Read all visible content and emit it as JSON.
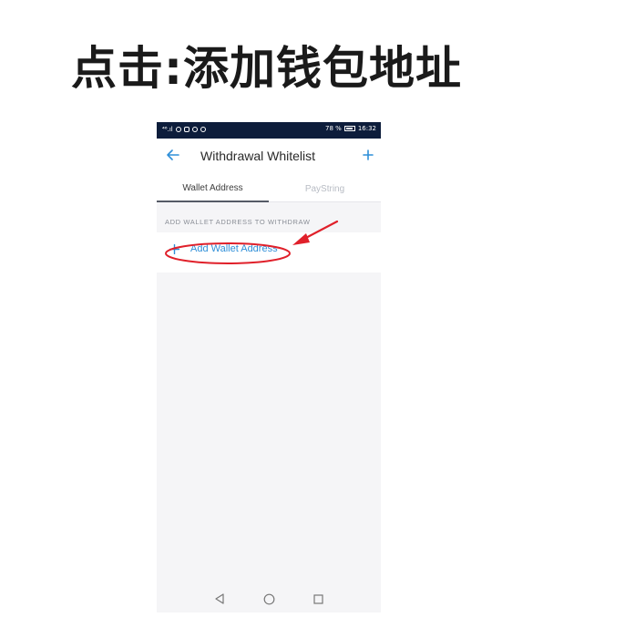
{
  "headline": "点击:添加钱包地址",
  "status_bar": {
    "left_text": "⁴⁶.ıl",
    "battery": "78 %",
    "time": "16:32"
  },
  "app_bar": {
    "title": "Withdrawal Whitelist",
    "back_icon": "arrow-left-icon",
    "add_icon": "plus-icon"
  },
  "tabs": [
    {
      "label": "Wallet Address",
      "active": true
    },
    {
      "label": "PayString",
      "active": false
    }
  ],
  "section": {
    "header": "ADD WALLET ADDRESS TO WITHDRAW",
    "add_button_label": "Add Wallet Address"
  },
  "colors": {
    "accent": "#2f8fd8",
    "status_bar": "#0d1d3b",
    "annotation_red": "#e0202a"
  },
  "nav_bar": {
    "back_icon": "triangle-back-icon",
    "home_icon": "circle-home-icon",
    "recents_icon": "square-recents-icon"
  }
}
